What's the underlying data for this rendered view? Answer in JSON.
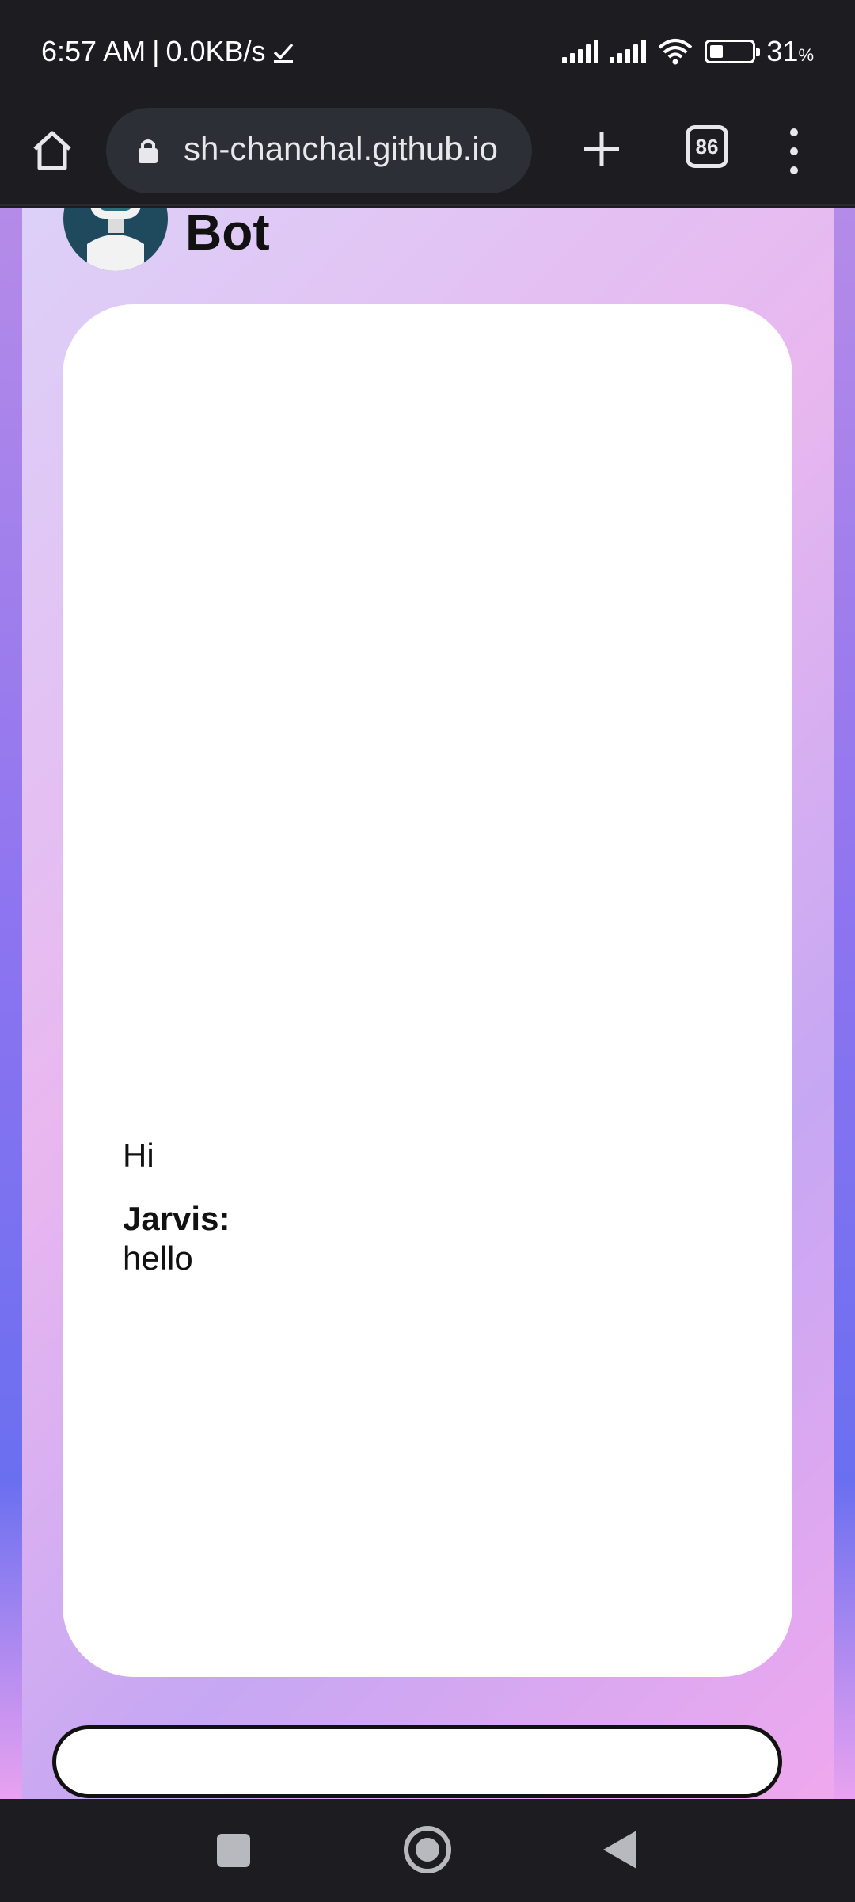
{
  "status_bar": {
    "time": "6:57 AM",
    "separator": "|",
    "net_speed": "0.0KB/s",
    "battery_percent": "31",
    "battery_unit": "%",
    "battery_level": 0.31
  },
  "browser": {
    "url": "sh-chanchal.github.io",
    "tab_count": "86"
  },
  "page": {
    "title": "Bot",
    "messages": [
      {
        "text": "Hi"
      }
    ],
    "bot_reply": {
      "name": "Jarvis:",
      "text": "hello"
    },
    "input_value": ""
  },
  "colors": {
    "system_bar": "#1c1c21",
    "chat_background": "#ffffff",
    "gradient_purple": "#b58be8",
    "gradient_pink": "#efa8ee"
  }
}
